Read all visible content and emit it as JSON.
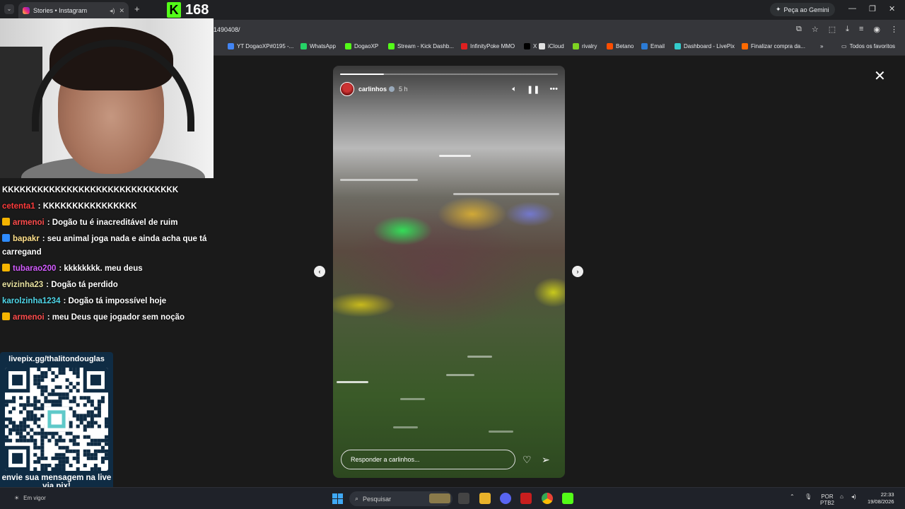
{
  "browser": {
    "tab_title": "Stories • Instagram",
    "url": "1490408/",
    "gemini_label": "Peça ao Gemini",
    "bookmarks": [
      {
        "label": "YT DogaoXP#0195 -...",
        "color": "#4285f4"
      },
      {
        "label": "WhatsApp",
        "color": "#25d366"
      },
      {
        "label": "DogaoXP",
        "color": "#53fc18"
      },
      {
        "label": "Stream - Kick Dashb...",
        "color": "#53fc18"
      },
      {
        "label": "InfinityPoke MMO",
        "color": "#e02020"
      },
      {
        "label": "X",
        "color": "#000000"
      },
      {
        "label": "iCloud",
        "color": "#e0e0e0"
      },
      {
        "label": "rivalry",
        "color": "#7ed321"
      },
      {
        "label": "Betano",
        "color": "#ff4e00"
      },
      {
        "label": "Email",
        "color": "#2b7bd6"
      },
      {
        "label": "Dashboard - LivePix",
        "color": "#3cc"
      },
      {
        "label": "Finalizar compra da...",
        "color": "#ff6a00"
      }
    ],
    "all_bookmarks_label": "Todos os favoritos"
  },
  "kick": {
    "logo_letter": "K",
    "viewer_count": "168",
    "accent": "#53fc18"
  },
  "story": {
    "username": "carlinhos",
    "time": "5 h",
    "reply_placeholder": "Responder a carlinhos...",
    "progress": 0.2
  },
  "chat": {
    "messages": [
      {
        "user": "",
        "user_color": "#ffffff",
        "badge": "",
        "text": "KKKKKKKKKKKKKKKKKKKKKKKKKKKKKK"
      },
      {
        "user": "cetenta1",
        "user_color": "#ff3b3b",
        "badge": "",
        "text": ": KKKKKKKKKKKKKKKK"
      },
      {
        "user": "armenoi",
        "user_color": "#ff4d4d",
        "badge": "crown",
        "text": ": Dogão tu é inacreditável de ruim"
      },
      {
        "user": "bapakr",
        "user_color": "#ffe08a",
        "badge": "blue",
        "text": ": seu animal joga nada e ainda acha que tá carregand"
      },
      {
        "user": "tubarao200",
        "user_color": "#d35cff",
        "badge": "crown",
        "text": ": kkkkkkkk. meu deus"
      },
      {
        "user": "evizinha23",
        "user_color": "#e8e2a0",
        "badge": "",
        "text": ": Dogão tá perdido"
      },
      {
        "user": "karolzinha1234",
        "user_color": "#4fd6e8",
        "badge": "",
        "text": ": Dogão tá impossível hoje"
      },
      {
        "user": "armenoi",
        "user_color": "#ff4d4d",
        "badge": "crown",
        "text": ": meu Deus que jogador sem noção"
      }
    ]
  },
  "livepix": {
    "url": "livepix.gg/thalitondouglas",
    "cta": "envie sua mensagem na live via pix!"
  },
  "taskbar": {
    "left_text": "Em vigor",
    "search_placeholder": "Pesquisar",
    "lang_line1": "POR",
    "lang_line2": "PTB2",
    "time": "22:33",
    "date": "19/08/2026"
  }
}
